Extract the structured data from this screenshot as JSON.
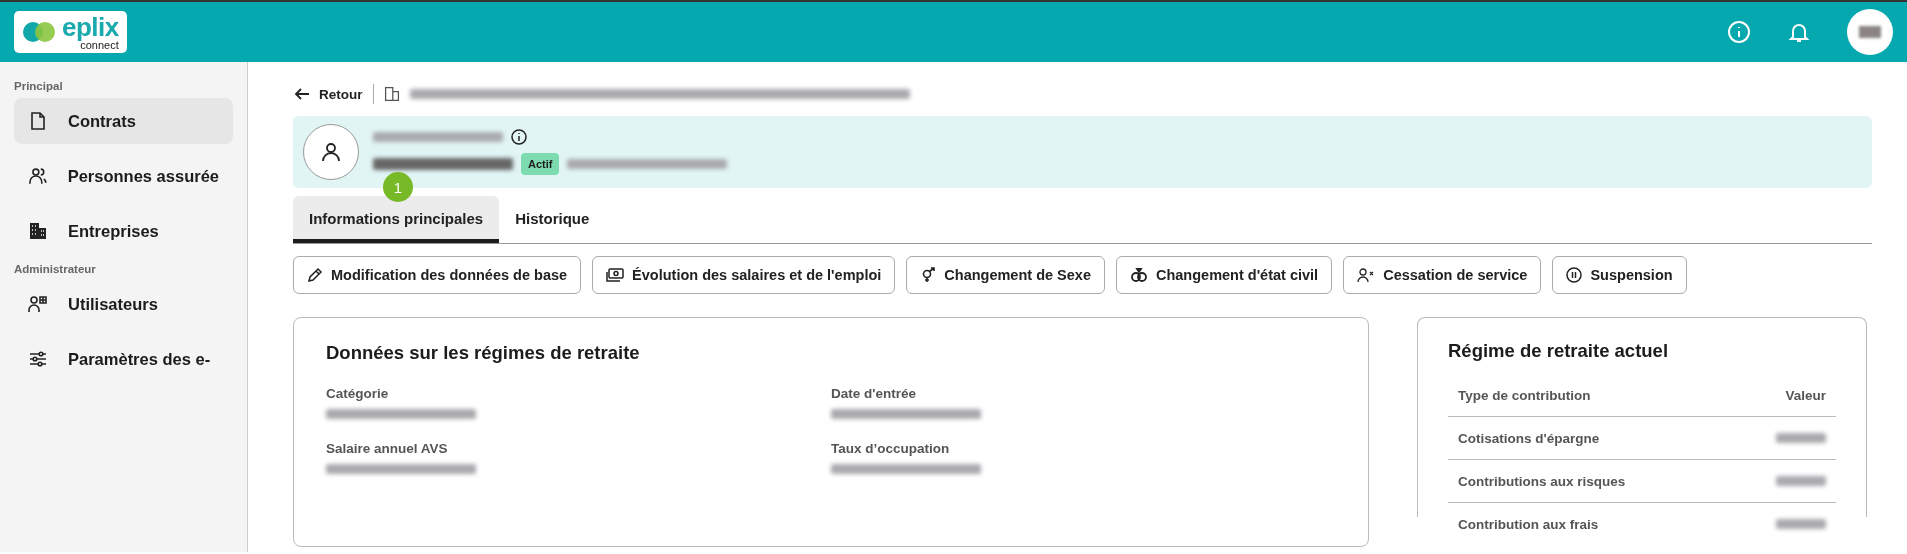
{
  "header": {
    "logo": {
      "word": "eplix",
      "sub": "connect"
    }
  },
  "sidebar": {
    "sections": [
      {
        "title": "Principal",
        "items": [
          {
            "label": "Contrats",
            "selected": true
          },
          {
            "label": "Personnes assurée",
            "selected": false
          },
          {
            "label": "Entreprises",
            "selected": false
          }
        ]
      },
      {
        "title": "Administrateur",
        "items": [
          {
            "label": "Utilisateurs",
            "selected": false
          },
          {
            "label": "Paramètres des e-",
            "selected": false
          }
        ]
      }
    ]
  },
  "back": {
    "label": "Retour"
  },
  "person": {
    "status": "Actif",
    "marker": "1"
  },
  "tabs": [
    {
      "label": "Informations principales",
      "selected": true
    },
    {
      "label": "Historique",
      "selected": false
    }
  ],
  "actions": [
    {
      "label": "Modification des données de base"
    },
    {
      "label": "Évolution des salaires et de l'emploi"
    },
    {
      "label": "Changement de Sexe"
    },
    {
      "label": "Changement d'état civil"
    },
    {
      "label": "Cessation de service"
    },
    {
      "label": "Suspension"
    }
  ],
  "pension_card": {
    "title": "Données sur les régimes de retraite",
    "fields": [
      {
        "label": "Catégorie"
      },
      {
        "label": "Date d'entrée"
      },
      {
        "label": "Salaire annuel AVS"
      },
      {
        "label": "Taux d’occupation"
      }
    ]
  },
  "current_card": {
    "title": "Régime de retraite actuel",
    "columns": [
      "Type de contribution",
      "Valeur"
    ],
    "rows": [
      {
        "type": "Cotisations d'épargne"
      },
      {
        "type": "Contributions aux risques"
      },
      {
        "type": "Contribution aux frais"
      }
    ]
  }
}
